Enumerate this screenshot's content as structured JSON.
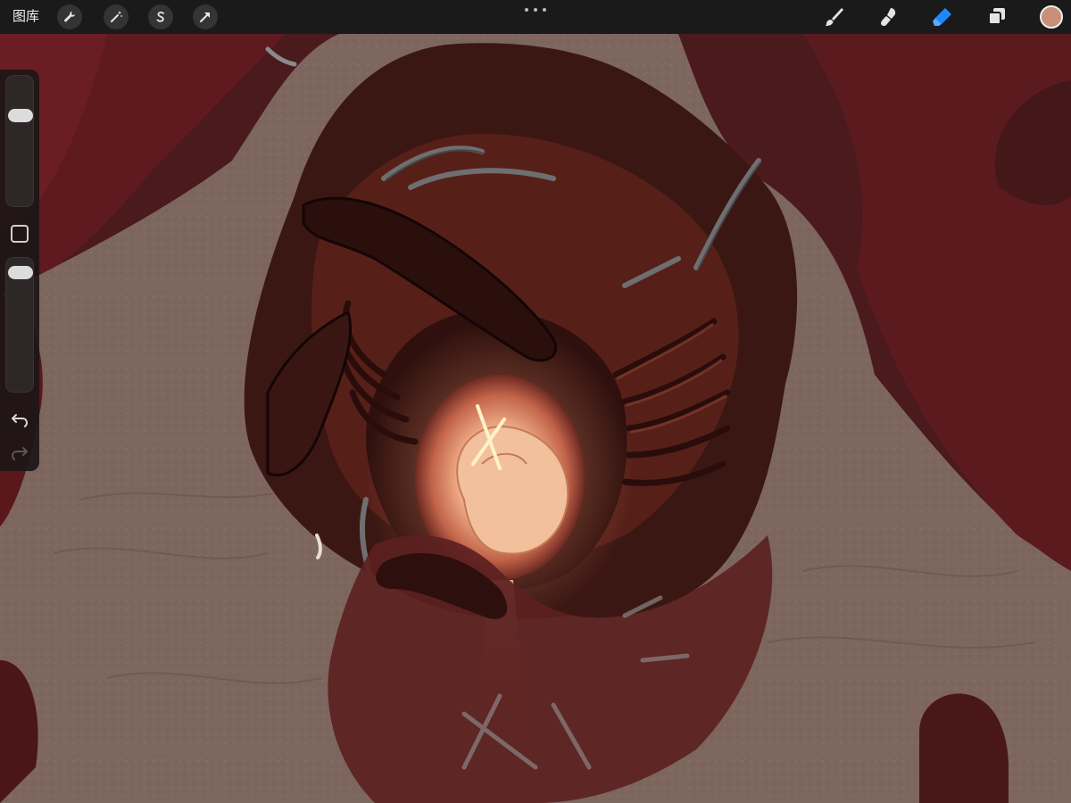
{
  "toolbar": {
    "gallery_label": "图库",
    "left_icons": [
      "wrench-icon",
      "magic-wand-icon",
      "selection-s-icon",
      "transform-arrow-icon"
    ],
    "right_tools": [
      "brush-icon",
      "smudge-icon",
      "eraser-icon",
      "layers-icon"
    ],
    "active_tool": "eraser-icon",
    "accent_color": "#1e88ff",
    "current_color": "#c98f78"
  },
  "sidebar": {
    "brush_size_level": 0.28,
    "brush_opacity_level": 0.07
  },
  "colors": {
    "canvas_beige": "#7e6a62",
    "flesh_dark": "#3d1a16",
    "flesh_red": "#6a1c1e",
    "glow": "#f6b68e"
  }
}
